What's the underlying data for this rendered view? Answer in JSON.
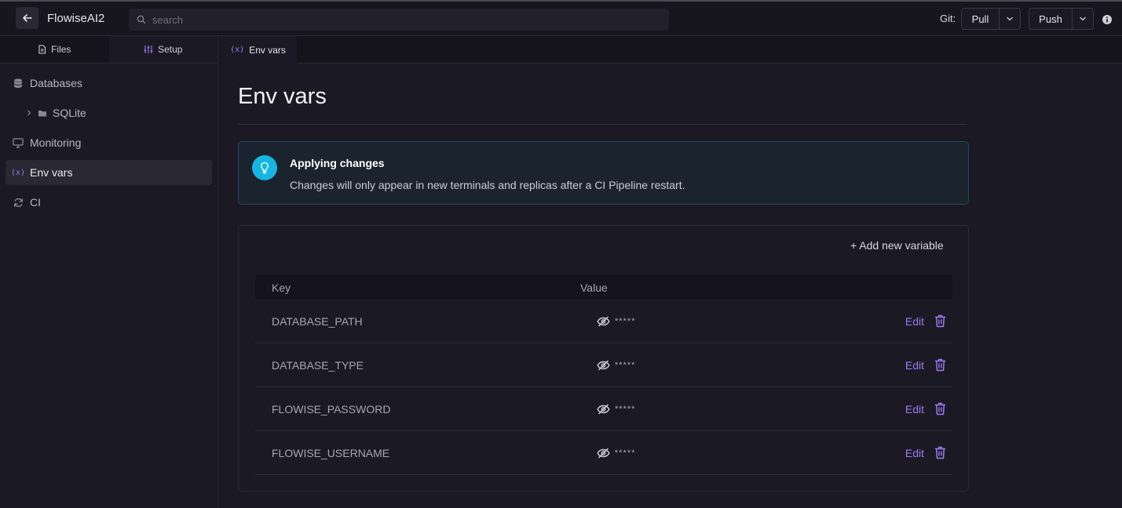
{
  "header": {
    "app_title": "FlowiseAI2",
    "search_placeholder": "search",
    "git_label": "Git:",
    "pull_label": "Pull",
    "push_label": "Push"
  },
  "sidebar": {
    "tabs": [
      {
        "label": "Files",
        "icon": "file-icon"
      },
      {
        "label": "Setup",
        "icon": "sliders-icon"
      }
    ],
    "items": [
      {
        "label": "Databases",
        "icon": "database-icon"
      },
      {
        "label": "SQLite",
        "icon": "folder-icon"
      },
      {
        "label": "Monitoring",
        "icon": "monitor-icon"
      },
      {
        "label": "Env vars",
        "icon": "variable-icon",
        "active": true
      },
      {
        "label": "CI",
        "icon": "refresh-icon"
      }
    ]
  },
  "tabs": {
    "env_vars": {
      "label": "Env vars",
      "icon_text": "(x)"
    }
  },
  "page": {
    "title": "Env vars",
    "callout": {
      "title": "Applying changes",
      "text": "Changes will only appear in new terminals and replicas after a CI Pipeline restart."
    },
    "add_button": "+ Add new variable",
    "table": {
      "headers": {
        "key": "Key",
        "value": "Value"
      },
      "rows": [
        {
          "key": "DATABASE_PATH",
          "value": "*****"
        },
        {
          "key": "DATABASE_TYPE",
          "value": "*****"
        },
        {
          "key": "FLOWISE_PASSWORD",
          "value": "*****"
        },
        {
          "key": "FLOWISE_USERNAME",
          "value": "*****"
        }
      ],
      "edit_label": "Edit"
    }
  },
  "colors": {
    "accent": "#9b7bf0",
    "callout_icon": "#16b6e3",
    "background": "#1b1a24"
  }
}
